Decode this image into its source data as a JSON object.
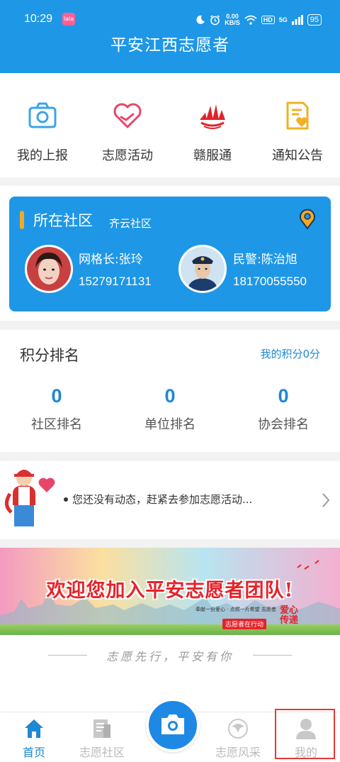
{
  "status_bar": {
    "time": "10:29",
    "app_badge": "lala",
    "net_speed_value": "0.00",
    "net_speed_unit": "KB/S",
    "hd_label": "HD",
    "network_label": "5G",
    "battery": "95"
  },
  "header": {
    "title": "平安江西志愿者"
  },
  "quick_menu": [
    {
      "label": "我的上报",
      "icon": "camera-outline-icon",
      "color": "#3aa4e8"
    },
    {
      "label": "志愿活动",
      "icon": "heart-hand-icon",
      "color": "#e8456a"
    },
    {
      "label": "赣服通",
      "icon": "ganfutong-logo-icon",
      "color": "#e0242a"
    },
    {
      "label": "通知公告",
      "icon": "notice-document-icon",
      "color": "#f0b126"
    }
  ],
  "community": {
    "title": "所在社区",
    "name": "齐云社区",
    "grid_leader": {
      "role": "网格长:张玲",
      "phone": "15279171131"
    },
    "police": {
      "role": "民警:陈治旭",
      "phone": "18170055550"
    }
  },
  "points": {
    "title": "积分排名",
    "my_points": "我的积分0分",
    "ranks": [
      {
        "value": "0",
        "label": "社区排名"
      },
      {
        "value": "0",
        "label": "单位排名"
      },
      {
        "value": "0",
        "label": "协会排名"
      }
    ]
  },
  "news": {
    "text": "您还没有动态，赶紧去参加志愿活动..."
  },
  "banner": {
    "headline": "欢迎您加入平安志愿者团队!",
    "sub": "奉献一份爱心 · 点燃一片希望 志愿者",
    "tag": "志愿者在行动",
    "love": "爱心传递"
  },
  "slogan": "志愿先行，平安有你",
  "tab_bar": {
    "tabs": [
      {
        "label": "首页",
        "icon": "home-icon",
        "active": true
      },
      {
        "label": "志愿社区",
        "icon": "community-doc-icon",
        "active": false
      },
      {
        "label": "志愿风采",
        "icon": "volunteer-style-icon",
        "active": false
      },
      {
        "label": "我的",
        "icon": "profile-icon",
        "active": false
      }
    ],
    "center_icon": "camera-icon"
  },
  "colors": {
    "primary": "#1e97e6",
    "accent_text": "#1e88d2",
    "highlight": "#e53935"
  }
}
